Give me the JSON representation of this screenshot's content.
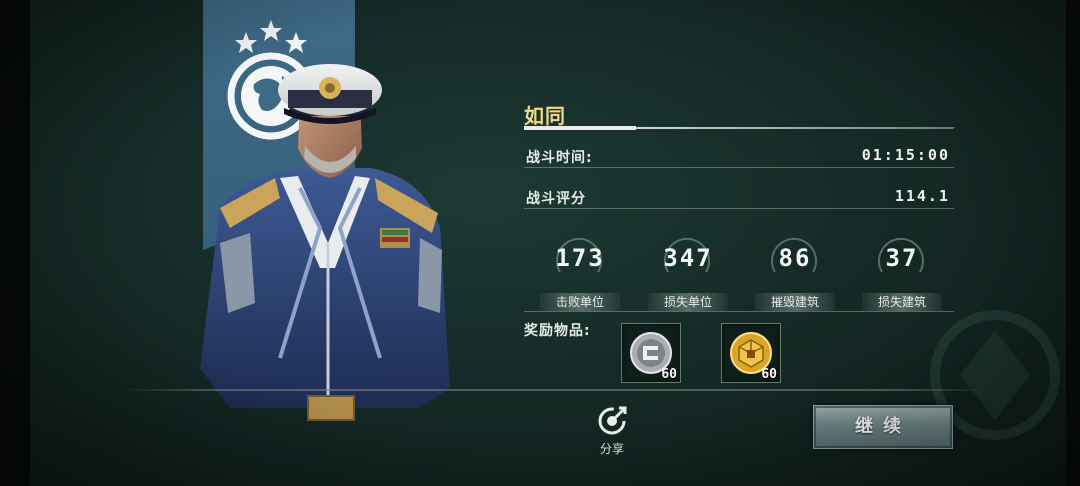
{
  "player": {
    "name": "如同"
  },
  "battle": {
    "time_label": "战斗时间:",
    "time_value": "01:15:00",
    "score_label": "战斗评分",
    "score_value": "114.1"
  },
  "stats": [
    {
      "value": "173",
      "label": "击败单位"
    },
    {
      "value": "347",
      "label": "损失单位"
    },
    {
      "value": "86",
      "label": "摧毁建筑"
    },
    {
      "value": "37",
      "label": "损失建筑"
    }
  ],
  "rewards": {
    "label": "奖励物品:",
    "items": [
      {
        "icon": "silver-medal-icon",
        "quantity": "60"
      },
      {
        "icon": "gold-cube-icon",
        "quantity": "60"
      }
    ]
  },
  "actions": {
    "share_label": "分享",
    "continue_label": "继续"
  },
  "colors": {
    "title_gold": "#f2d98a",
    "banner_blue": "#3f6a87",
    "background": "#152a26"
  }
}
